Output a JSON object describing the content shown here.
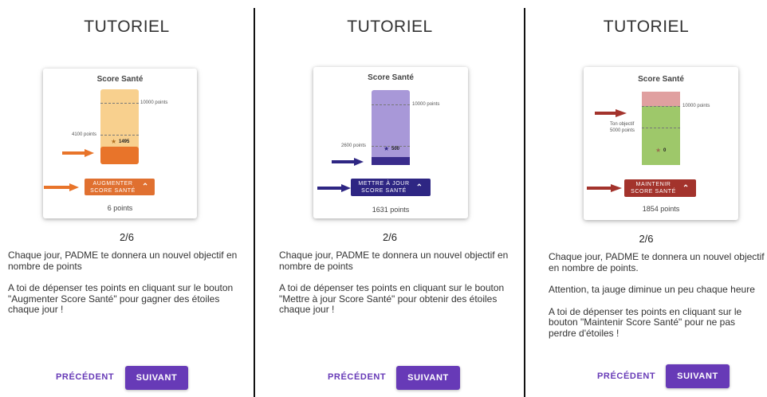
{
  "panels": [
    {
      "title": "TUTORIEL",
      "card_title": "Score Santé",
      "goal_label": "10000 points",
      "target_label": "4100 points",
      "star_value": "1495",
      "button_line1": "AUGMENTER",
      "button_line2": "SCORE SANTÉ",
      "points": "6 points",
      "page": "2/6",
      "paragraph1": "Chaque jour, PADME te donnera un nouvel objectif en nombre de points",
      "paragraph2": "A toi de dépenser tes points en cliquant sur le bouton \"Augmenter Score Santé\" pour gagner des étoiles chaque jour !",
      "prev": "PRÉCÉDENT",
      "next": "SUIVANT",
      "colors": {
        "gauge": "#f8d08e",
        "fill": "#e8742a",
        "button": "#e07030",
        "arrow": "#e8742a"
      }
    },
    {
      "title": "TUTORIEL",
      "card_title": "Score Santé",
      "goal_label": "10000 points",
      "target_label": "2600 points",
      "star_value": "500",
      "button_line1": "METTRE À JOUR",
      "button_line2": "SCORE SANTÉ",
      "points": "1631 points",
      "page": "2/6",
      "paragraph1": "Chaque jour, PADME te donnera un nouvel objectif en nombre de points",
      "paragraph2": "A toi de dépenser tes points en cliquant sur le bouton \"Mettre à jour Score Santé\" pour obtenir des étoiles chaque jour !",
      "prev": "PRÉCÉDENT",
      "next": "SUIVANT",
      "colors": {
        "gauge": "#a898d8",
        "fill": "#3a2c8c",
        "button": "#2e2683",
        "arrow": "#2e2683"
      }
    },
    {
      "title": "TUTORIEL",
      "card_title": "Score Santé",
      "goal_label": "10000 points",
      "target_label_1": "Ton objectif",
      "target_label_2": "5000 points",
      "star_value": "0",
      "button_line1": "MAINTENIR",
      "button_line2": "SCORE SANTÉ",
      "points": "1854 points",
      "page": "2/6",
      "paragraph1": "Chaque jour, PADME te donnera un nouvel objectif en nombre de points.",
      "paragraph2": "Attention, ta jauge diminue un peu chaque heure",
      "paragraph3": "A toi de dépenser tes points en cliquant sur le bouton \"Maintenir Score Santé\" pour ne pas perdre d'étoiles !",
      "prev": "PRÉCÉDENT",
      "next": "SUIVANT",
      "colors": {
        "gauge_top": "#e0a0a0",
        "gauge": "#9ec86a",
        "button": "#a3332c",
        "arrow": "#a3332c"
      }
    }
  ]
}
